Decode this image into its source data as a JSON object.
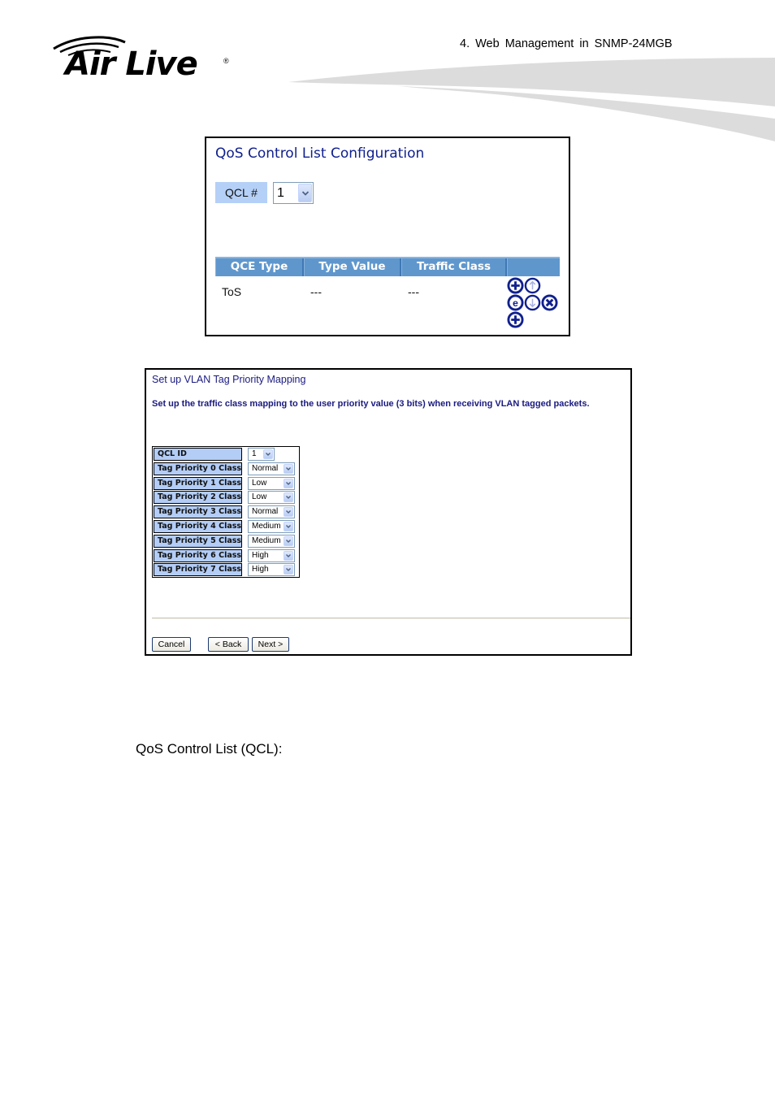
{
  "header": {
    "logo_text": "Air Live",
    "logo_registered": "®",
    "chapter_title": "4.  Web Management in SNMP-24MGB"
  },
  "qcl_panel": {
    "title": "QoS Control List Configuration",
    "qcl_label": "QCL #",
    "qcl_select_value": "1",
    "table_headers": [
      "QCE Type",
      "Type Value",
      "Traffic Class",
      ""
    ],
    "rows": [
      {
        "qce_type": "ToS",
        "type_value": "---",
        "traffic_class": "---",
        "actions": [
          "insert-icon",
          "move-up-icon",
          "edit-icon",
          "move-down-icon",
          "delete-icon",
          "add-icon"
        ]
      }
    ],
    "icon_color": "#10208e"
  },
  "vlan_panel": {
    "title": "Set up VLAN Tag Priority Mapping",
    "description": "Set up the traffic class mapping to the user priority value (3 bits) when receiving VLAN tagged packets.",
    "qcl_id_label": "QCL ID",
    "qcl_id_value": "1",
    "mappings": [
      {
        "label": "Tag Priority 0 Class",
        "value": "Normal"
      },
      {
        "label": "Tag Priority 1 Class",
        "value": "Low"
      },
      {
        "label": "Tag Priority 2 Class",
        "value": "Low"
      },
      {
        "label": "Tag Priority 3 Class",
        "value": "Normal"
      },
      {
        "label": "Tag Priority 4 Class",
        "value": "Medium"
      },
      {
        "label": "Tag Priority 5 Class",
        "value": "Medium"
      },
      {
        "label": "Tag Priority 6 Class",
        "value": "High"
      },
      {
        "label": "Tag Priority 7 Class",
        "value": "High"
      }
    ],
    "buttons": {
      "cancel": "Cancel",
      "back": "< Back",
      "next": "Next >"
    }
  },
  "body": {
    "section_heading": "QoS Control List (QCL):"
  }
}
